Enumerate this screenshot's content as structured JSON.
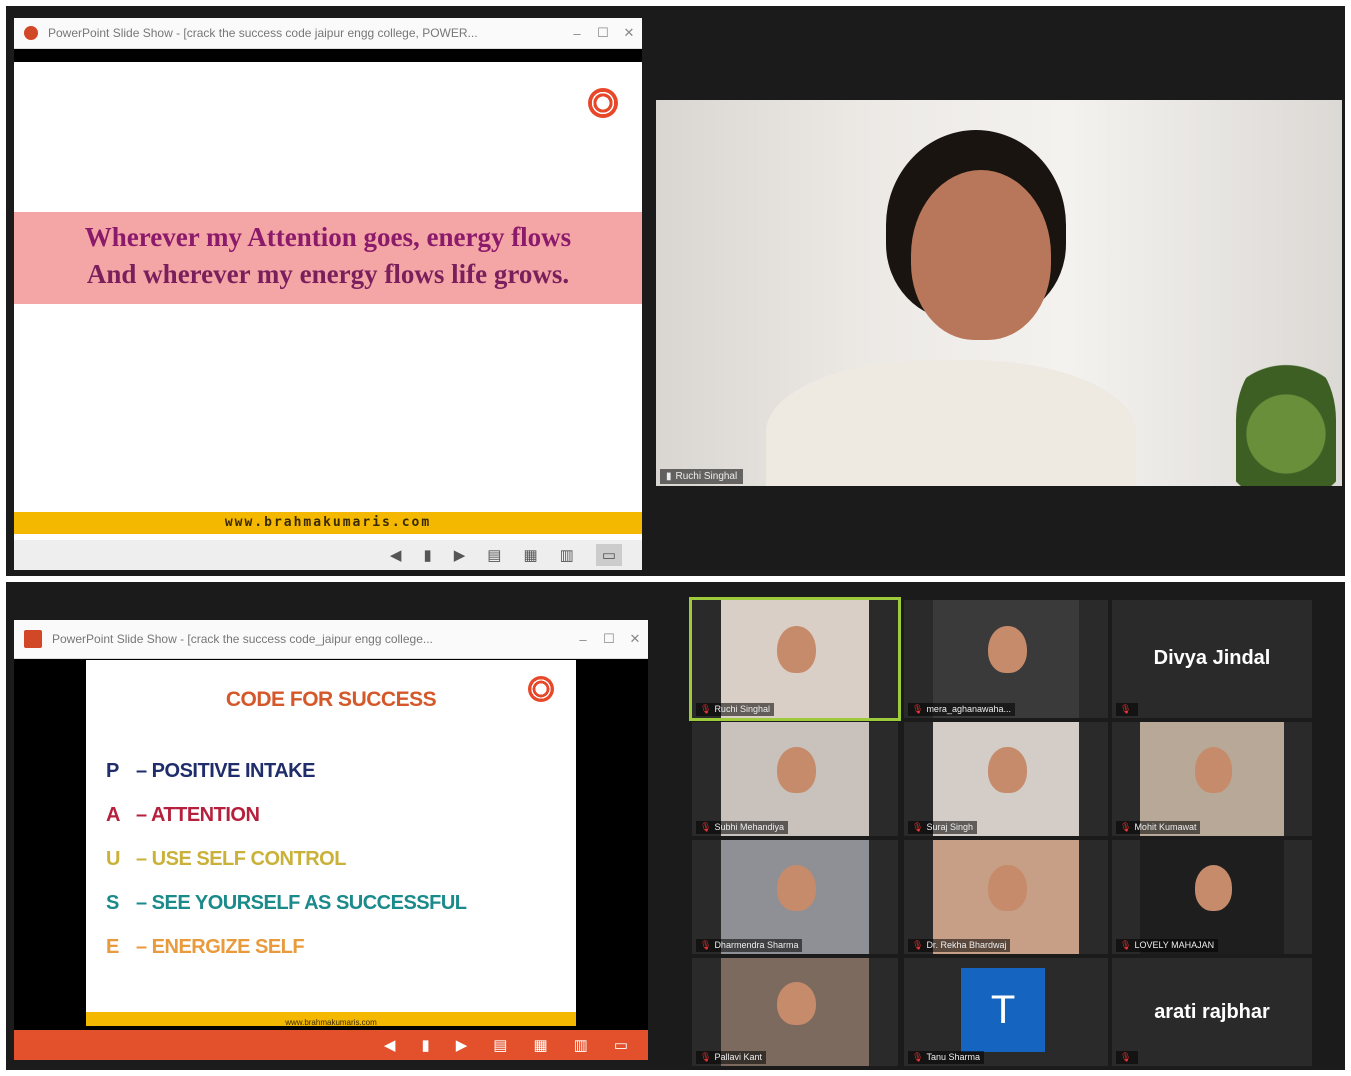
{
  "top_slideshow": {
    "window_title": "PowerPoint Slide Show - [crack the success code jaipur engg college, POWER...",
    "quote_line1": "Wherever my Attention goes, energy flows",
    "quote_line2": "And wherever my energy flows life grows.",
    "footer_url": "www.brahmakumaris.com",
    "colors": {
      "band": "#f4a6a6",
      "text_primary": "#8b1a6b",
      "text_secondary": "#7a1f5c",
      "footer": "#f5b800"
    }
  },
  "speaker_video": {
    "name": "Ruchi Singhal"
  },
  "bottom_slideshow": {
    "window_title": "PowerPoint Slide Show - [crack the success code_jaipur engg college...",
    "heading": "CODE FOR SUCCESS",
    "items": [
      {
        "letter": "P",
        "text": "– POSITIVE INTAKE",
        "color": "#1f2d6b"
      },
      {
        "letter": "A",
        "text": "– ATTENTION",
        "color": "#b5203c"
      },
      {
        "letter": "U",
        "text": "– USE SELF CONTROL",
        "color": "#c9b13a"
      },
      {
        "letter": "S",
        "text": "– SEE YOURSELF AS SUCCESSFUL",
        "color": "#1a8a8a"
      },
      {
        "letter": "E",
        "text": "– ENERGIZE SELF",
        "color": "#e89a3c"
      }
    ],
    "footer_url": "www.brahmakumaris.com",
    "colors": {
      "heading": "#d4582a",
      "footer": "#f5b800",
      "control_bar": "#e2502c"
    }
  },
  "gallery": {
    "tiles": [
      {
        "name": "Ruchi Singhal",
        "type": "video"
      },
      {
        "name": "mera_aghanawaha...",
        "type": "video"
      },
      {
        "name": "Divya Jindal",
        "type": "name"
      },
      {
        "name": "Subhi Mehandiya",
        "type": "video"
      },
      {
        "name": "Suraj Singh",
        "type": "video"
      },
      {
        "name": "Mohit Kumawat",
        "type": "video"
      },
      {
        "name": "Dharmendra Sharma",
        "type": "video"
      },
      {
        "name": "Dr. Rekha Bhardwaj",
        "type": "video"
      },
      {
        "name": "LOVELY MAHAJAN",
        "type": "video"
      },
      {
        "name": "Pallavi Kant",
        "type": "video"
      },
      {
        "name": "Tanu Sharma",
        "type": "avatar",
        "initial": "T"
      },
      {
        "name": "arati rajbhar",
        "type": "name"
      }
    ]
  }
}
